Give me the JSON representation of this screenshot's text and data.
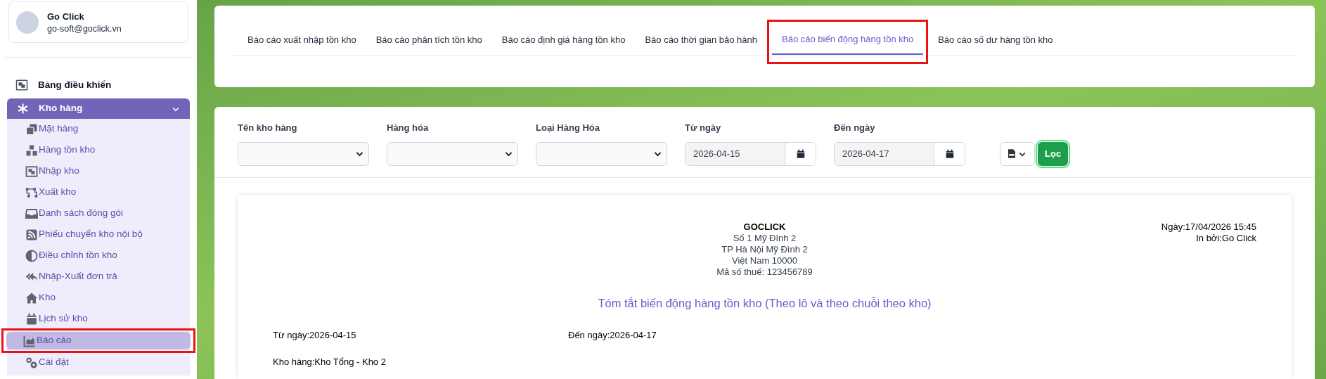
{
  "user": {
    "name": "Go Click",
    "email": "go-soft@goclick.vn"
  },
  "sidebar": {
    "items": [
      {
        "label": "Bảng điều khiển",
        "kind": "top",
        "selected": false
      },
      {
        "label": "Kho hàng",
        "kind": "group",
        "expanded": true,
        "selected": true,
        "children": [
          {
            "label": "Mặt hàng",
            "selected": false,
            "highlighted": false
          },
          {
            "label": "Hàng tồn kho",
            "selected": false,
            "highlighted": false
          },
          {
            "label": "Nhập kho",
            "selected": false,
            "highlighted": false
          },
          {
            "label": "Xuất kho",
            "selected": false,
            "highlighted": false
          },
          {
            "label": "Danh sách đóng gói",
            "selected": false,
            "highlighted": false
          },
          {
            "label": "Phiếu chuyển kho nội bộ",
            "selected": false,
            "highlighted": false
          },
          {
            "label": "Điều chỉnh tồn kho",
            "selected": false,
            "highlighted": false
          },
          {
            "label": "Nhập-Xuất đơn trả",
            "selected": false,
            "highlighted": false
          },
          {
            "label": "Kho",
            "selected": false,
            "highlighted": false
          },
          {
            "label": "Lịch sử kho",
            "selected": false,
            "highlighted": false
          },
          {
            "label": "Báo cáo",
            "selected": true,
            "highlighted": true
          },
          {
            "label": "Cài đặt",
            "selected": false,
            "highlighted": false
          }
        ]
      }
    ]
  },
  "tabs": [
    {
      "label": "Báo cáo xuất nhập tồn kho",
      "selected": false,
      "highlighted": false
    },
    {
      "label": "Báo cáo phân tích tồn kho",
      "selected": false,
      "highlighted": false
    },
    {
      "label": "Báo cáo định giá hàng tồn kho",
      "selected": false,
      "highlighted": false
    },
    {
      "label": "Báo cáo thời gian bảo hành",
      "selected": false,
      "highlighted": false
    },
    {
      "label": "Báo cáo biến động hàng tồn kho",
      "selected": true,
      "highlighted": true
    },
    {
      "label": "Báo cáo số dư hàng tồn kho",
      "selected": false,
      "highlighted": false
    }
  ],
  "filters": [
    {
      "label": "Tên kho hàng",
      "kind": "select"
    },
    {
      "label": "Hàng hóa",
      "kind": "select"
    },
    {
      "label": "Loại Hàng Hóa",
      "kind": "select"
    },
    {
      "label": "Từ ngày",
      "kind": "date",
      "value": "2026-04-15"
    },
    {
      "label": "Đến ngày",
      "kind": "date",
      "value": "2026-04-17"
    }
  ],
  "filter_button": "Lọc",
  "report": {
    "company": [
      "GOCLICK",
      "Số 1 Mỹ Đình 2",
      "TP Hà Nội Mỹ Đình 2",
      "Việt Nam 10000",
      "Mã số thuế: 123456789"
    ],
    "meta": [
      "Ngày:17/04/2026 15:45",
      "In bởi:Go Click"
    ],
    "title": "Tóm tắt biến động hàng tồn kho (Theo lô và theo chuỗi theo kho)",
    "from_date": "Từ ngày:2026-04-15",
    "to_date": "Đến ngày:2026-04-17",
    "warehouse": "Kho hàng:Kho Tổng - Kho 2"
  }
}
